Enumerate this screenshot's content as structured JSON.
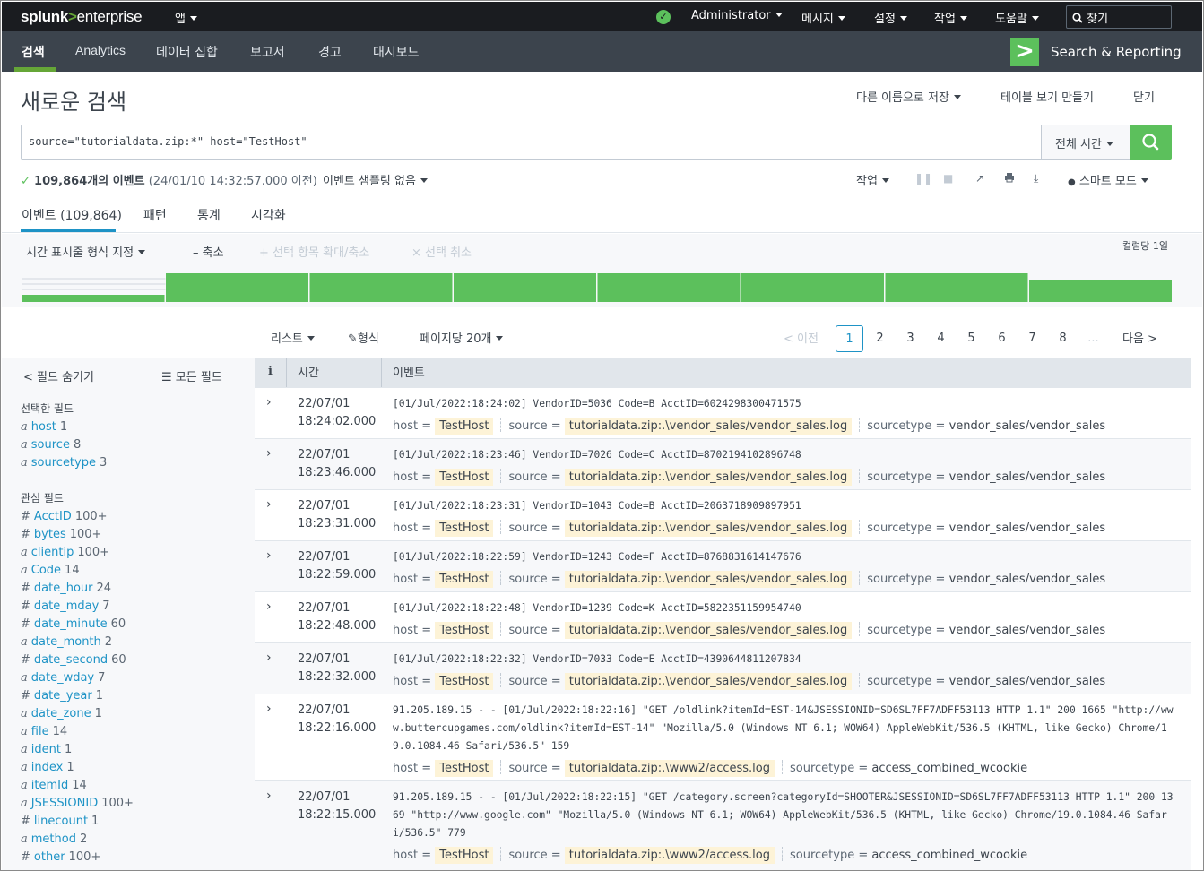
{
  "topbar": {
    "logo_splunk": "splunk",
    "logo_gt": ">",
    "logo_enterprise": "enterprise",
    "apps": "앱",
    "user": "Administrator",
    "messages": "메시지",
    "settings": "설정",
    "activity": "작업",
    "help": "도움말",
    "find": "찾기",
    "status_icon": "check-circle-icon"
  },
  "appbar": {
    "tabs": [
      "검색",
      "Analytics",
      "데이터 집합",
      "보고서",
      "경고",
      "대시보드"
    ],
    "app_name": "Search & Reporting",
    "app_logo": ">"
  },
  "title": {
    "text": "새로운 검색",
    "save_as": "다른 이름으로 저장",
    "create_table": "테이블 보기 만들기",
    "close": "닫기"
  },
  "search": {
    "query": "source=\"tutorialdata.zip:*\" host=\"TestHost\"",
    "time_range": "전체 시간"
  },
  "status": {
    "check": "✓",
    "count": "109,864개의 이벤트",
    "timestamp": "(24/01/10 14:32:57.000 이전)",
    "sampling": "이벤트 샘플링 없음",
    "job": "작업",
    "mode": "스마트 모드"
  },
  "result_tabs": [
    "이벤트 (109,864)",
    "패턴",
    "통계",
    "시각화"
  ],
  "timeline": {
    "format": "시간 표시줄 형식 지정",
    "zoom_out": "– 축소",
    "zoom_sel": "+ 선택 항목 확대/축소",
    "deselect": "× 선택 취소",
    "per_col": "컬럼당 1일",
    "bars": [
      0.25,
      1,
      1,
      1,
      1,
      1,
      1,
      0.75
    ]
  },
  "results_controls": {
    "list": "리스트",
    "format": "형식",
    "per_page": "페이지당 20개",
    "prev": "< 이전",
    "pages": [
      "1",
      "2",
      "3",
      "4",
      "5",
      "6",
      "7",
      "8",
      "..."
    ],
    "next": "다음 >"
  },
  "sidebar": {
    "hide_fields": "< 필드 숨기기",
    "all_fields": "모든 필드",
    "selected_header": "선택한 필드",
    "selected": [
      {
        "t": "a",
        "name": "host",
        "count": "1"
      },
      {
        "t": "a",
        "name": "source",
        "count": "8"
      },
      {
        "t": "a",
        "name": "sourcetype",
        "count": "3"
      }
    ],
    "interesting_header": "관심 필드",
    "interesting": [
      {
        "t": "#",
        "name": "AcctID",
        "count": "100+"
      },
      {
        "t": "#",
        "name": "bytes",
        "count": "100+"
      },
      {
        "t": "a",
        "name": "clientip",
        "count": "100+"
      },
      {
        "t": "a",
        "name": "Code",
        "count": "14"
      },
      {
        "t": "#",
        "name": "date_hour",
        "count": "24"
      },
      {
        "t": "#",
        "name": "date_mday",
        "count": "7"
      },
      {
        "t": "#",
        "name": "date_minute",
        "count": "60"
      },
      {
        "t": "a",
        "name": "date_month",
        "count": "2"
      },
      {
        "t": "#",
        "name": "date_second",
        "count": "60"
      },
      {
        "t": "a",
        "name": "date_wday",
        "count": "7"
      },
      {
        "t": "#",
        "name": "date_year",
        "count": "1"
      },
      {
        "t": "a",
        "name": "date_zone",
        "count": "1"
      },
      {
        "t": "a",
        "name": "file",
        "count": "14"
      },
      {
        "t": "a",
        "name": "ident",
        "count": "1"
      },
      {
        "t": "a",
        "name": "index",
        "count": "1"
      },
      {
        "t": "a",
        "name": "itemId",
        "count": "14"
      },
      {
        "t": "a",
        "name": "JSESSIONID",
        "count": "100+"
      },
      {
        "t": "#",
        "name": "linecount",
        "count": "1"
      },
      {
        "t": "a",
        "name": "method",
        "count": "2"
      },
      {
        "t": "#",
        "name": "other",
        "count": "100+"
      }
    ]
  },
  "events": {
    "header": {
      "info": "i",
      "time": "시간",
      "event": "이벤트"
    },
    "rows": [
      {
        "date": "22/07/01",
        "time": "18:24:02.000",
        "raw": "[01/Jul/2022:18:24:02] VendorID=5036 Code=B AcctID=6024298300471575",
        "host": "TestHost",
        "source": "tutorialdata.zip:.\\vendor_sales/vendor_sales.log",
        "sourcetype": "vendor_sales/vendor_sales"
      },
      {
        "date": "22/07/01",
        "time": "18:23:46.000",
        "raw": "[01/Jul/2022:18:23:46] VendorID=7026 Code=C AcctID=8702194102896748",
        "host": "TestHost",
        "source": "tutorialdata.zip:.\\vendor_sales/vendor_sales.log",
        "sourcetype": "vendor_sales/vendor_sales"
      },
      {
        "date": "22/07/01",
        "time": "18:23:31.000",
        "raw": "[01/Jul/2022:18:23:31] VendorID=1043 Code=B AcctID=2063718909897951",
        "host": "TestHost",
        "source": "tutorialdata.zip:.\\vendor_sales/vendor_sales.log",
        "sourcetype": "vendor_sales/vendor_sales"
      },
      {
        "date": "22/07/01",
        "time": "18:22:59.000",
        "raw": "[01/Jul/2022:18:22:59] VendorID=1243 Code=F AcctID=8768831614147676",
        "host": "TestHost",
        "source": "tutorialdata.zip:.\\vendor_sales/vendor_sales.log",
        "sourcetype": "vendor_sales/vendor_sales"
      },
      {
        "date": "22/07/01",
        "time": "18:22:48.000",
        "raw": "[01/Jul/2022:18:22:48] VendorID=1239 Code=K AcctID=5822351159954740",
        "host": "TestHost",
        "source": "tutorialdata.zip:.\\vendor_sales/vendor_sales.log",
        "sourcetype": "vendor_sales/vendor_sales"
      },
      {
        "date": "22/07/01",
        "time": "18:22:32.000",
        "raw": "[01/Jul/2022:18:22:32] VendorID=7033 Code=E AcctID=4390644811207834",
        "host": "TestHost",
        "source": "tutorialdata.zip:.\\vendor_sales/vendor_sales.log",
        "sourcetype": "vendor_sales/vendor_sales"
      },
      {
        "date": "22/07/01",
        "time": "18:22:16.000",
        "raw": "91.205.189.15 - - [01/Jul/2022:18:22:16] \"GET /oldlink?itemId=EST-14&JSESSIONID=SD6SL7FF7ADFF53113 HTTP 1.1\" 200 1665 \"http://www.buttercupgames.com/oldlink?itemId=EST-14\" \"Mozilla/5.0 (Windows NT 6.1; WOW64) AppleWebKit/536.5 (KHTML, like Gecko) Chrome/19.0.1084.46 Safari/536.5\" 159",
        "host": "TestHost",
        "source": "tutorialdata.zip:.\\www2/access.log",
        "sourcetype": "access_combined_wcookie"
      },
      {
        "date": "22/07/01",
        "time": "18:22:15.000",
        "raw": "91.205.189.15 - - [01/Jul/2022:18:22:15] \"GET /category.screen?categoryId=SHOOTER&JSESSIONID=SD6SL7FF7ADFF53113 HTTP 1.1\" 200 1369 \"http://www.google.com\" \"Mozilla/5.0 (Windows NT 6.1; WOW64) AppleWebKit/536.5 (KHTML, like Gecko) Chrome/19.0.1084.46 Safari/536.5\" 779",
        "host": "TestHost",
        "source": "tutorialdata.zip:.\\www2/access.log",
        "sourcetype": "access_combined_wcookie"
      }
    ],
    "labels": {
      "host": "host",
      "source": "source",
      "sourcetype": "sourcetype",
      "eq": " = "
    }
  },
  "colors": {
    "accent": "#65a637",
    "button_green": "#5cc05c",
    "link": "#1e93c6",
    "topbar": "#1a1c20",
    "appbar": "#3c444d"
  }
}
